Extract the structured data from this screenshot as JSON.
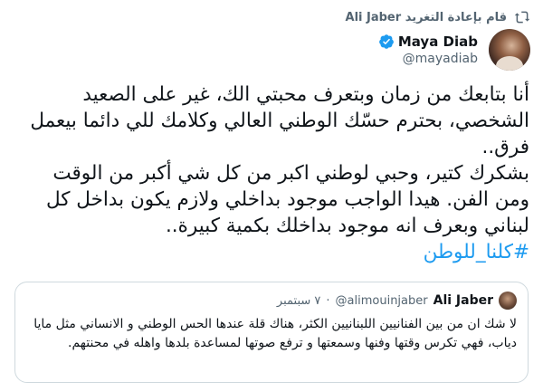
{
  "retweet": {
    "text": "Ali Jaber قام بإعادة التغريد",
    "icon": "retweet-icon"
  },
  "author": {
    "display_name": "Maya Diab",
    "handle": "@mayadiab",
    "verified": true,
    "verified_color": "#1d9bf0"
  },
  "tweet": {
    "text": "أنا بتابعك من زمان وبتعرف محبتي الك، غير على الصعيد الشخصي، بحترم حسّك الوطني العالي وكلامك للي دائما بيعمل فرق..\nبشكرك كتير، وحبي لوطني اكبر من كل شي أكبر من الوقت ومن الفن. هيدا الواجب موجود بداخلي ولازم يكون بداخل كل لبناني وبعرف انه موجود بداخلك بكمية كبيرة..",
    "hashtag": "#كلنا_للوطن",
    "hashtag_color": "#1d9bf0"
  },
  "quoted_tweet": {
    "display_name": "Ali Jaber",
    "handle": "@alimouinjaber",
    "date": "٧ سبتمبر",
    "text": "لا شك ان من بين الفنانيين اللبنانيين الكثر، هناك قلة عندها الحس الوطني و الانساني مثل مايا دياب، فهي تكرس وقتها وفنها وسمعتها و ترفع صوتها لمساعدة بلدها واهله في محنتهم."
  }
}
